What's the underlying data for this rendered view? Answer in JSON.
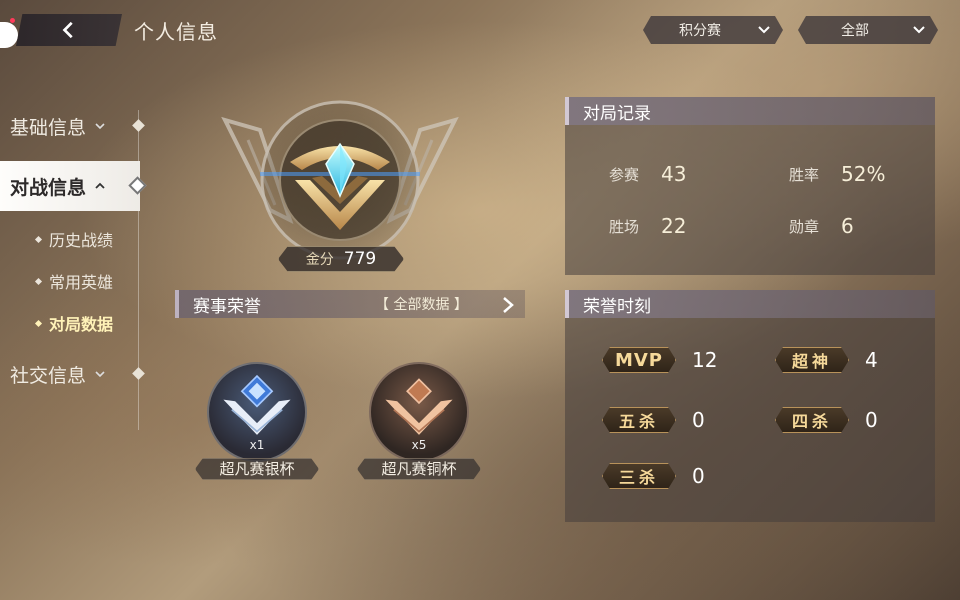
{
  "header": {
    "title": "个人信息",
    "mode_dropdown": "积分赛",
    "scope_dropdown": "全部"
  },
  "sidebar": {
    "items": [
      {
        "label": "基础信息"
      },
      {
        "label": "对战信息"
      },
      {
        "label": "社交信息"
      }
    ],
    "sub_items": [
      {
        "label": "历史战绩"
      },
      {
        "label": "常用英雄"
      },
      {
        "label": "对局数据"
      }
    ]
  },
  "badge": {
    "score_label": "金分",
    "score_value": "779"
  },
  "honors": {
    "title": "赛事荣誉",
    "link": "【 全部数据 】",
    "trophies": [
      {
        "count": "x1",
        "name": "超凡赛银杯",
        "color": "#6aa8ff"
      },
      {
        "count": "x5",
        "name": "超凡赛铜杯",
        "color": "#e0a27a"
      }
    ]
  },
  "record": {
    "title": "对局记录",
    "stats": [
      {
        "label": "参赛",
        "value": "43"
      },
      {
        "label": "胜率",
        "value": "52%"
      },
      {
        "label": "胜场",
        "value": "22"
      },
      {
        "label": "勋章",
        "value": "6"
      }
    ]
  },
  "moments": {
    "title": "荣誉时刻",
    "stats": [
      {
        "label": "MVP",
        "value": "12"
      },
      {
        "label": "超神",
        "value": "4"
      },
      {
        "label": "五杀",
        "value": "0"
      },
      {
        "label": "四杀",
        "value": "0"
      },
      {
        "label": "三杀",
        "value": "0"
      }
    ]
  }
}
